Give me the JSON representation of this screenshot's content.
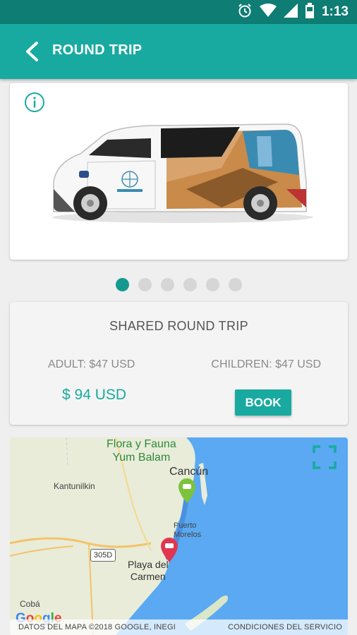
{
  "status_bar": {
    "time": "1:13",
    "icons": [
      "alarm-icon",
      "wifi-icon",
      "signal-icon",
      "battery-icon"
    ]
  },
  "app_bar": {
    "title": "ROUND TRIP",
    "back_icon": "chevron-left-icon"
  },
  "gallery": {
    "info_icon": "info-icon",
    "dots": [
      {
        "active": true
      },
      {
        "active": false
      },
      {
        "active": false
      },
      {
        "active": false
      },
      {
        "active": false
      },
      {
        "active": false
      }
    ]
  },
  "trip": {
    "title": "SHARED ROUND TRIP",
    "adult_price": "ADULT: $47 USD",
    "children_price": "CHILDREN: $47 USD",
    "total": "$ 94 USD",
    "book_label": "BOOK"
  },
  "map": {
    "labels": {
      "flora_line1": "Flora y Fauna",
      "flora_line2": "Yum Balam",
      "cancun": "Cancún",
      "kantunilkin": "Kantunilkin",
      "puerto_line1": "Puerto",
      "puerto_line2": "Morelos",
      "playa_line1": "Playa del",
      "playa_line2": "Carmen",
      "coba": "Cobá",
      "road": "305D"
    },
    "google_letters": [
      "G",
      "o",
      "o",
      "g",
      "l",
      "e"
    ],
    "attribution": "DATOS DEL MAPA ©2018 GOOGLE, INEGI",
    "terms": "CONDICIONES DEL SERVICIO"
  },
  "colors": {
    "status_bar": "#0e7d74",
    "app_bar": "#18aaa0",
    "accent": "#18aaa0",
    "pin_origin": "#7cc23a",
    "pin_destination": "#e0364f",
    "route": "#4a90e2",
    "sea": "#5aa9f2"
  }
}
